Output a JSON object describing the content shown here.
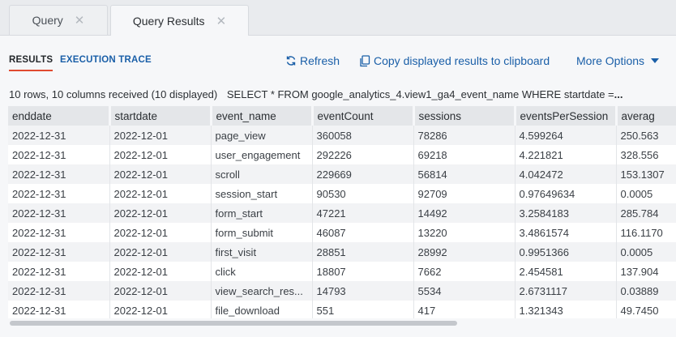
{
  "tabs": [
    {
      "label": "Query",
      "close": "✕"
    },
    {
      "label": "Query Results",
      "close": "✕"
    }
  ],
  "subnav": {
    "results": "RESULTS",
    "execution_trace": "EXECUTION TRACE",
    "refresh": "Refresh",
    "copy": "Copy displayed results to clipboard",
    "more_options": "More Options"
  },
  "summary": {
    "rows_info": "10 rows, 10 columns received (10 displayed)",
    "sql": "SELECT * FROM google_analytics_4.view1_ga4_event_name WHERE startdate =",
    "ellipsis": "..."
  },
  "colors": {
    "accent": "#1a5fa8",
    "active_underline": "#e04a30"
  },
  "table": {
    "columns": [
      "enddate",
      "startdate",
      "event_name",
      "eventCount",
      "sessions",
      "eventsPerSession",
      "averag"
    ],
    "rows": [
      [
        "2022-12-31",
        "2022-12-01",
        "page_view",
        "360058",
        "78286",
        "4.599264",
        "250.563"
      ],
      [
        "2022-12-31",
        "2022-12-01",
        "user_engagement",
        "292226",
        "69218",
        "4.221821",
        "328.556"
      ],
      [
        "2022-12-31",
        "2022-12-01",
        "scroll",
        "229669",
        "56814",
        "4.042472",
        "153.1307"
      ],
      [
        "2022-12-31",
        "2022-12-01",
        "session_start",
        "90530",
        "92709",
        "0.97649634",
        "0.0005"
      ],
      [
        "2022-12-31",
        "2022-12-01",
        "form_start",
        "47221",
        "14492",
        "3.2584183",
        "285.784"
      ],
      [
        "2022-12-31",
        "2022-12-01",
        "form_submit",
        "46087",
        "13220",
        "3.4861574",
        "116.1170"
      ],
      [
        "2022-12-31",
        "2022-12-01",
        "first_visit",
        "28851",
        "28992",
        "0.9951366",
        "0.0005"
      ],
      [
        "2022-12-31",
        "2022-12-01",
        "click",
        "18807",
        "7662",
        "2.454581",
        "137.904"
      ],
      [
        "2022-12-31",
        "2022-12-01",
        "view_search_res...",
        "14793",
        "5534",
        "2.6731117",
        "0.03889"
      ],
      [
        "2022-12-31",
        "2022-12-01",
        "file_download",
        "551",
        "417",
        "1.321343",
        "49.7450"
      ]
    ]
  }
}
